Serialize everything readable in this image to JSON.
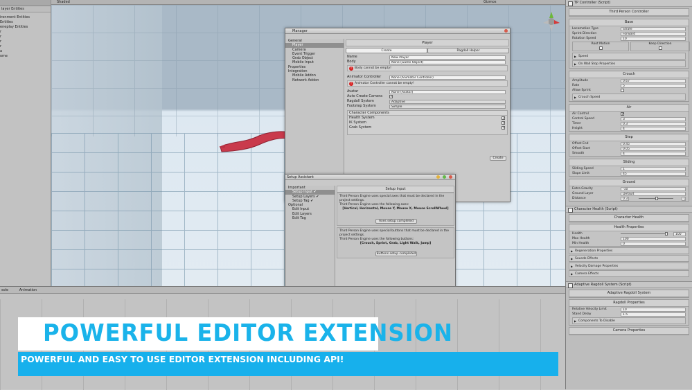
{
  "hierarchy": {
    "header": "layer Entities",
    "items": [
      "ironment Entities",
      "Entities",
      "eneplay Entities",
      "r",
      "r",
      "r",
      "r",
      "a",
      "",
      "",
      "ome"
    ]
  },
  "scene_toolbar": {
    "shaded": "Shaded",
    "gizmos": "Gizmos"
  },
  "manager": {
    "title": "Manager",
    "nav": [
      {
        "label": "General",
        "level": 0
      },
      {
        "label": "Player",
        "level": 1,
        "selected": true
      },
      {
        "label": "Camera",
        "level": 1
      },
      {
        "label": "Event Trigger",
        "level": 1
      },
      {
        "label": "Grab Object",
        "level": 1
      },
      {
        "label": "Mobile Input",
        "level": 1
      },
      {
        "label": "Properties",
        "level": 0
      },
      {
        "label": "Integration",
        "level": 0
      },
      {
        "label": "Mobile Addon",
        "level": 1
      },
      {
        "label": "Network Addon",
        "level": 1
      }
    ],
    "section": "Player",
    "tabs": [
      "Create",
      "Ragdoll Helper"
    ],
    "name_label": "Name",
    "name_value": "New Player",
    "body_label": "Body",
    "body_value": "None (Game Object)",
    "body_error": "Body cannot be empty!",
    "animator_label": "Animator Controller",
    "animator_value": "None (Animator Controller)",
    "animator_error": "Animator Controller cannot be empty!",
    "avatar_label": "Avatar",
    "avatar_value": "None (Avatar)",
    "auto_camera_label": "Auto Create Camera",
    "ragdoll_label": "Ragdoll System",
    "ragdoll_value": "Adaptive",
    "footstep_label": "Footstep System",
    "footstep_value": "Simple",
    "components_title": "Character Components",
    "components": [
      "Health System",
      "IK System",
      "Grab System"
    ],
    "create_button": "Create"
  },
  "setup": {
    "title": "Setup Assistant",
    "nav": [
      {
        "label": "Important",
        "level": 0
      },
      {
        "label": "Setup Input ✔",
        "level": 1,
        "selected": true
      },
      {
        "label": "Setup Layers ✔",
        "level": 1
      },
      {
        "label": "Setup Tag ✔",
        "level": 1
      },
      {
        "label": "Optional",
        "level": 0
      },
      {
        "label": "Edit Input",
        "level": 1
      },
      {
        "label": "Edit Layers",
        "level": 1
      },
      {
        "label": "Edit Tag",
        "level": 1
      }
    ],
    "section": "Setup Input",
    "text1": "Third Person Engine uses special axes that must be declared in the project settings.",
    "text2": "Third Person Engine uses the following axes:",
    "axes": "[Vertical, Horizontal, Mouse Y, Mouse X, Mouse ScrollWheel]",
    "axes_button": "Axes setup completed",
    "text3": "Third Person Engine uses special buttons that must be declared in the project settings.",
    "text4": "Third Person Engine uses the following buttons:",
    "buttons": "[Crouch, Sprint, Grab, Light Walk, Jump]",
    "buttons_button": "Buttons setup completed"
  },
  "inspector": {
    "tp_controller": {
      "header": "TP Controller (Script)",
      "title": "Third Person Controller",
      "base": {
        "title": "Base",
        "rows": [
          {
            "label": "Locomotion Type",
            "value": "Strafe"
          },
          {
            "label": "Sprint Direction",
            "value": "Forward"
          },
          {
            "label": "Rotation Speed",
            "value": "10"
          }
        ],
        "root_motion": "Root Motion",
        "keep_direction": "Keep Direction",
        "folds": [
          "Speed",
          "On Wall Stop Properties"
        ]
      },
      "crouch": {
        "title": "Crouch",
        "rows": [
          {
            "label": "Amplitude",
            "value": "0.67"
          },
          {
            "label": "Rate",
            "value": "5"
          },
          {
            "label": "Allow Sprint",
            "value": ""
          }
        ],
        "fold": "Crouch Speed"
      },
      "air": {
        "title": "Air",
        "rows": [
          {
            "label": "Air Control",
            "value": "✔"
          },
          {
            "label": "Control Speed",
            "value": "3"
          },
          {
            "label": "Timer",
            "value": "0.3"
          },
          {
            "label": "Height",
            "value": "4"
          }
        ]
      },
      "step": {
        "title": "Step",
        "rows": [
          {
            "label": "Offset End",
            "value": "0.45"
          },
          {
            "label": "Offset Start",
            "value": "0.05"
          },
          {
            "label": "Smooth",
            "value": "4"
          }
        ]
      },
      "sliding": {
        "title": "Sliding",
        "rows": [
          {
            "label": "Sliding Speed",
            "value": "1"
          },
          {
            "label": "Slope Limit",
            "value": "45"
          }
        ]
      },
      "ground": {
        "title": "Ground",
        "rows": [
          {
            "label": "Extra Gravity",
            "value": "-10"
          },
          {
            "label": "Ground Layer",
            "value": "Default"
          },
          {
            "label": "Distance",
            "value": "0.3"
          }
        ],
        "distance_end": "0.5"
      }
    },
    "character_health": {
      "header": "Character Health (Script)",
      "title": "Character Health",
      "props_title": "Health Properties",
      "rows": [
        {
          "label": "Health",
          "value": "100"
        },
        {
          "label": "Max Health",
          "value": "100"
        },
        {
          "label": "Min Health",
          "value": "0"
        }
      ],
      "folds": [
        "Regeneration Properties",
        "Sounds Effects",
        "Velocity Damage Properties",
        "Camera Effects"
      ]
    },
    "adaptive_ragdoll": {
      "header": "Adaptive Ragdoll System (Script)",
      "title": "Adaptive Ragdoll System",
      "props_title": "Ragdoll Properties",
      "rows": [
        {
          "label": "Relative Velocity Limit",
          "value": "10"
        },
        {
          "label": "Stand Delay",
          "value": "1.5"
        }
      ],
      "fold": "Components To Disable",
      "camera_title": "Camera Properties"
    }
  },
  "bottom": {
    "tab_console": "sole",
    "tab_animation": "Animation"
  },
  "banner": {
    "title": "POWERFUL EDITOR EXTENSION",
    "subtitle": "POWERFUL AND EASY TO USE EDITOR EXTENSION INCLUDING API!",
    "title_color": "#1ab3ea",
    "subtitle_bg": "#17b0ec"
  }
}
